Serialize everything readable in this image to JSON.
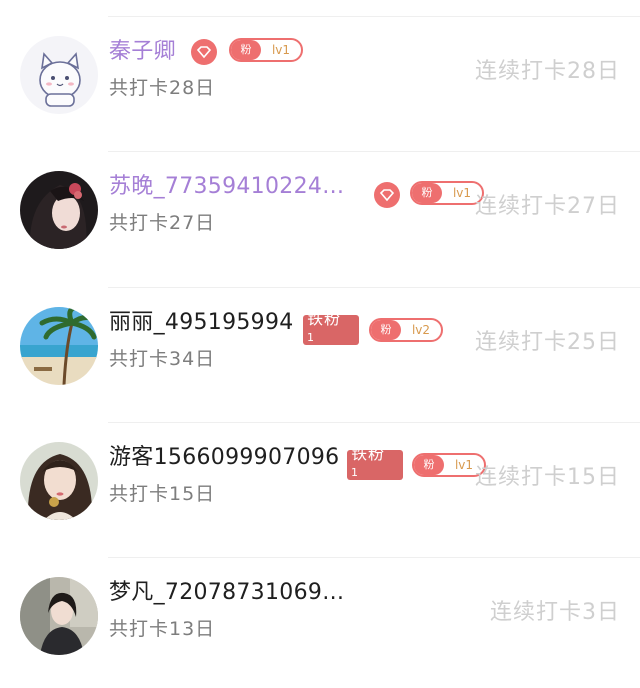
{
  "accent_color": "#ee6f6f",
  "vip_name_color": "#a57fd6",
  "users": [
    {
      "name": "秦子卿",
      "total": "共打卡28日",
      "streak": "连续打卡28日",
      "diamond_badge": true,
      "fan_badge": {
        "label": "粉",
        "level": "lv1"
      },
      "avatar": "cat-avatar"
    },
    {
      "name": "苏晚_77359410224…",
      "total": "共打卡27日",
      "streak": "连续打卡27日",
      "diamond_badge": true,
      "fan_badge": {
        "label": "粉",
        "level": "lv1"
      },
      "avatar": "girl-avatar"
    },
    {
      "name": "丽丽_495195994",
      "total": "共打卡34日",
      "streak": "连续打卡25日",
      "iron_badge": {
        "label": "铁粉",
        "count": "1"
      },
      "fan_badge": {
        "label": "粉",
        "level": "lv2"
      },
      "avatar": "beach-avatar"
    },
    {
      "name": "游客1566099907096",
      "total": "共打卡15日",
      "streak": "连续打卡15日",
      "iron_badge": {
        "label": "铁粉",
        "count": "1"
      },
      "fan_badge": {
        "label": "粉",
        "level": "lv1"
      },
      "avatar": "woman-avatar"
    },
    {
      "name": "梦凡_72078731069…",
      "total": "共打卡13日",
      "streak": "连续打卡3日",
      "avatar": "person-avatar"
    }
  ]
}
